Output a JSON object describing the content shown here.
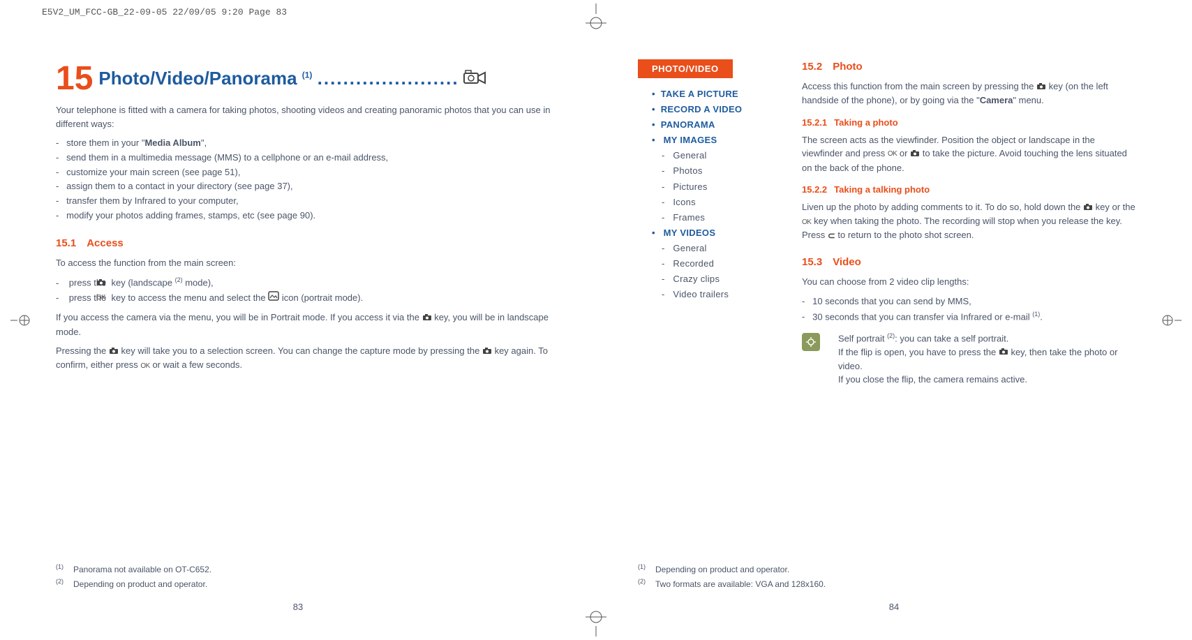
{
  "header": {
    "doc_tag": "E5V2_UM_FCC-GB_22-09-05  22/09/05  9:20  Page 83"
  },
  "left_page": {
    "chapter_number": "15",
    "chapter_title": "Photo/Video/Panorama",
    "chapter_sup": "(1)",
    "dots": "......................",
    "intro": "Your telephone is fitted with a camera for taking photos, shooting videos and creating panoramic photos that you can use in different ways:",
    "intro_bullets": [
      {
        "pre": "store them in your \"",
        "bold": "Media Album",
        "post": "\","
      },
      {
        "pre": "send them in a multimedia message (MMS) to a cellphone or an e-mail address,",
        "bold": "",
        "post": ""
      },
      {
        "pre": "customize your main screen (see page 51),",
        "bold": "",
        "post": ""
      },
      {
        "pre": "assign them to a contact in your directory (see page 37),",
        "bold": "",
        "post": ""
      },
      {
        "pre": "transfer them by Infrared to your computer,",
        "bold": "",
        "post": ""
      },
      {
        "pre": "modify your photos adding frames, stamps, etc (see page 90).",
        "bold": "",
        "post": ""
      }
    ],
    "s15_1": {
      "num": "15.1",
      "title": "Access",
      "p1": "To access the function from the main screen:",
      "b1_pre": "press the ",
      "b1_post": " key (landscape ",
      "b1_sup": "(2)",
      "b1_end": " mode),",
      "b2_pre": "press the ",
      "b2_mid": " key to access the menu and select the ",
      "b2_end": " icon (portrait mode).",
      "p2_pre": "If you access the camera via the menu, you will be in Portrait mode. If you access it via the ",
      "p2_post": " key, you will be in landscape mode.",
      "p3_pre": "Pressing the ",
      "p3_mid": " key will take you to a selection screen. You can change the capture mode by pressing the ",
      "p3_mid2": " key again. To confirm, either press ",
      "p3_end": " or wait a few seconds."
    },
    "footnotes": {
      "f1_ref": "(1)",
      "f1": "Panorama not available on OT-C652.",
      "f2_ref": "(2)",
      "f2": "Depending on product and operator."
    },
    "page_number": "83"
  },
  "right_page": {
    "tag": "PHOTO/VIDEO",
    "nav": {
      "items": [
        {
          "label": "TAKE A PICTURE"
        },
        {
          "label": "RECORD A VIDEO"
        },
        {
          "label": "PANORAMA"
        },
        {
          "label": "MY IMAGES",
          "sub": [
            "General",
            "Photos",
            "Pictures",
            "Icons",
            "Frames"
          ]
        },
        {
          "label": "MY VIDEOS",
          "sub": [
            "General",
            "Recorded",
            "Crazy clips",
            "Video trailers"
          ]
        }
      ]
    },
    "s15_2": {
      "num": "15.2",
      "title": "Photo",
      "p1_pre": "Access this function from the main screen by pressing the ",
      "p1_mid": " key (on the left handside of the phone), or by going via the \"",
      "p1_bold": "Camera",
      "p1_end": "\" menu.",
      "sub1_num": "15.2.1",
      "sub1_title": "Taking a photo",
      "sub1_pre": "The screen acts as the viewfinder. Position the object or landscape in the viewfinder and press ",
      "sub1_or": " or ",
      "sub1_end": " to take the picture. Avoid touching the lens situated on the back of the phone.",
      "sub2_num": "15.2.2",
      "sub2_title": "Taking a talking photo",
      "sub2_pre": "Liven up the photo by adding comments to it. To do so, hold down the ",
      "sub2_mid": " key or the ",
      "sub2_mid2": " key when taking the photo. The recording will stop when you release the key. Press ",
      "sub2_end": " to return to the photo shot screen."
    },
    "s15_3": {
      "num": "15.3",
      "title": "Video",
      "p1": "You can choose from 2 video clip lengths:",
      "b1": "10 seconds that you can send by MMS,",
      "b2_pre": "30 seconds that you can transfer via Infrared or e-mail ",
      "b2_sup": "(1)",
      "b2_end": ".",
      "tip1_pre": "Self portrait ",
      "tip1_sup": "(2)",
      "tip1_end": ": you can take a self portrait.",
      "tip2_pre": "If the flip is open, you have to press the ",
      "tip2_end": " key, then take the photo or video.",
      "tip3": "If you close the flip, the camera remains active."
    },
    "footnotes": {
      "f1_ref": "(1)",
      "f1": "Depending on product and operator.",
      "f2_ref": "(2)",
      "f2": "Two formats are available: VGA and 128x160."
    },
    "page_number": "84"
  }
}
